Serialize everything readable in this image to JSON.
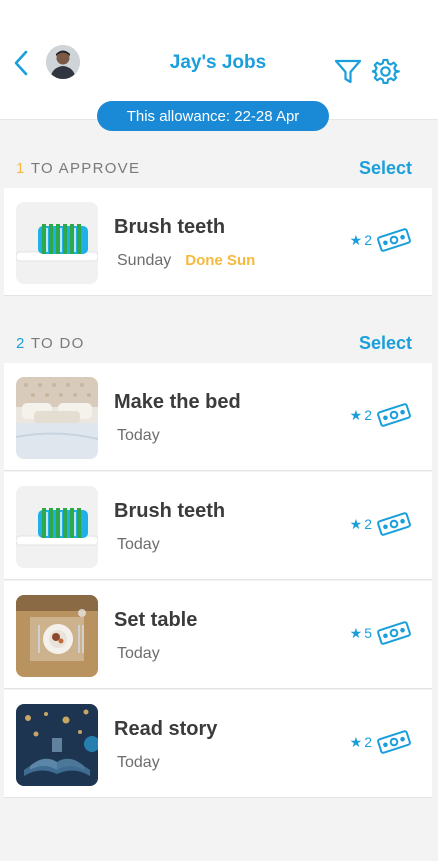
{
  "header": {
    "title": "Jay's Jobs",
    "allowance_label": "This allowance: 22-28 Apr",
    "icons": {
      "back": "chevron-left-icon",
      "filter": "filter-icon",
      "settings": "gear-icon",
      "avatar": "avatar-photo"
    }
  },
  "colors": {
    "accent": "#1a9fdc",
    "pill": "#1a8ad6",
    "approve_accent": "#f5b93d",
    "background": "#f3f3f3"
  },
  "sections": {
    "approve": {
      "count": "1",
      "label": " TO APPROVE",
      "select_label": "Select",
      "items": [
        {
          "name": "Brush teeth",
          "day": "Sunday",
          "status": "Done Sun",
          "stars": "2",
          "image": "toothbrush"
        }
      ]
    },
    "todo": {
      "count": "2",
      "label": " TO DO",
      "select_label": "Select",
      "items": [
        {
          "name": "Make the bed",
          "day": "Today",
          "stars": "2",
          "image": "bed"
        },
        {
          "name": "Brush teeth",
          "day": "Today",
          "stars": "2",
          "image": "toothbrush"
        },
        {
          "name": "Set table",
          "day": "Today",
          "stars": "5",
          "image": "table"
        },
        {
          "name": "Read story",
          "day": "Today",
          "stars": "2",
          "image": "book"
        }
      ]
    }
  }
}
